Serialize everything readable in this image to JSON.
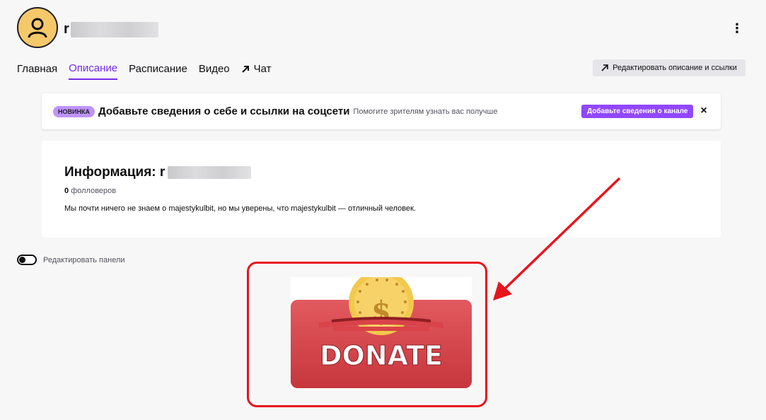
{
  "header": {
    "channel_initial": "r"
  },
  "tabs": [
    {
      "label": "Главная"
    },
    {
      "label": "Описание"
    },
    {
      "label": "Расписание"
    },
    {
      "label": "Видео"
    },
    {
      "label": "Чат"
    }
  ],
  "edit_description_label": "Редактировать описание и ссылки",
  "notice": {
    "badge": "новинка",
    "title": "Добавьте сведения о себе и ссылки на соцсети",
    "subtitle": "Помогите зрителям узнать вас получше",
    "cta": "Добавьте сведения о канале",
    "close": "×"
  },
  "info": {
    "title_prefix": "Информация: r",
    "followers_count": "0",
    "followers_label": "фолловеров",
    "bio": "Мы почти ничего не знаем о majestykulbit, но мы уверены, что majestykulbit — отличный человек."
  },
  "edit_panels_label": "Редактировать панели",
  "donate_panel": {
    "text": "DONATE",
    "coin_symbol": "$"
  },
  "colors": {
    "accent": "#772ce8",
    "cta": "#9147ff",
    "badge": "#bf94ff",
    "highlight": "#e8141c",
    "donate_red": "#d9434a",
    "coin": "#f2c94c"
  }
}
